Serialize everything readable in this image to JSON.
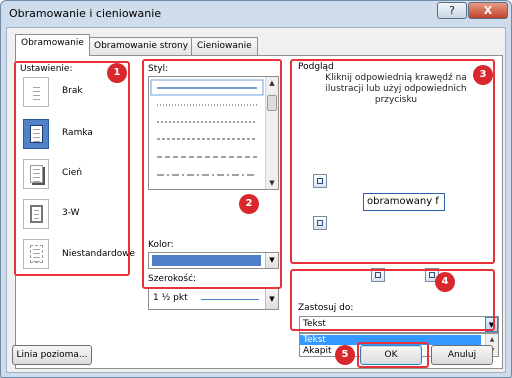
{
  "window": {
    "title": "Obramowanie i cieniowanie",
    "help_glyph": "?",
    "close_glyph": "X"
  },
  "tabs": [
    {
      "label": "Obramowanie",
      "active": true
    },
    {
      "label": "Obramowanie strony",
      "active": false
    },
    {
      "label": "Cieniowanie",
      "active": false
    }
  ],
  "setting": {
    "label": "Ustawienie:",
    "presets": [
      {
        "label": "Brak",
        "selected": false
      },
      {
        "label": "Ramka",
        "selected": true
      },
      {
        "label": "Cień",
        "selected": false
      },
      {
        "label": "3-W",
        "selected": false
      },
      {
        "label": "Niestandardowe",
        "selected": false
      }
    ]
  },
  "style": {
    "label": "Styl:",
    "options": [
      "solid",
      "dotted",
      "small-dots",
      "dash-dot",
      "dashed",
      "long-dash"
    ],
    "color_label": "Kolor:",
    "color_value": "#4f7fc9",
    "width_label": "Szerokość:",
    "width_value": "1 ½ pkt"
  },
  "preview": {
    "label": "Podgląd",
    "instruction": "Kliknij odpowiednią krawędź na ilustracji lub użyj odpowiednich przycisku",
    "sample_text": "obramowany f"
  },
  "apply_to": {
    "label": "Zastosuj do:",
    "value": "Tekst",
    "options": [
      "Tekst",
      "Akapit"
    ],
    "highlighted": "Tekst"
  },
  "buttons": {
    "horizontal_line": "Linia pozioma...",
    "ok": "OK",
    "cancel": "Anuluj"
  },
  "markers": [
    "1",
    "2",
    "3",
    "4",
    "5"
  ],
  "colors": {
    "marker": "#e8313a",
    "selection": "#3399ff",
    "accent": "#4f82c7"
  }
}
